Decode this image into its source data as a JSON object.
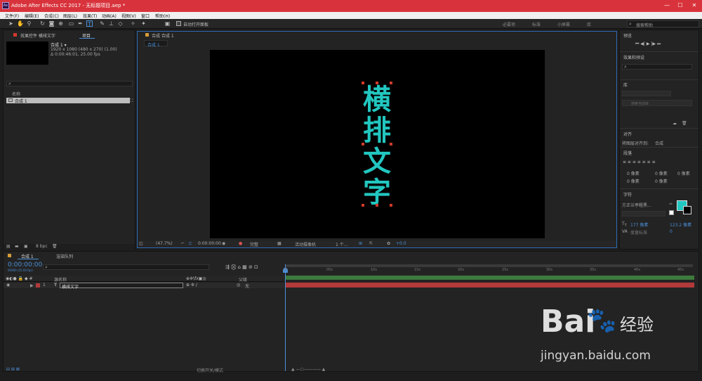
{
  "titlebar": {
    "app_icon": "Ae",
    "title": "Adobe After Effects CC 2017 - 无标题项目.aep *",
    "minimize": "—",
    "maximize": "☐",
    "close": "✕"
  },
  "menu": [
    "文件(F)",
    "编辑(E)",
    "合成(C)",
    "图层(L)",
    "效果(T)",
    "动画(A)",
    "视图(V)",
    "窗口",
    "帮助(H)"
  ],
  "toolbar": {
    "auto_open": "自动打开面板",
    "workspaces": [
      "必要项",
      "标准",
      "小屏幕",
      "库"
    ],
    "search_placeholder": "搜索帮助"
  },
  "project": {
    "tab_effects": "效果控件 横排文字",
    "tab_project": "项目",
    "comp_name": "合成 1 ▾",
    "comp_info1": "1920 x 1080 (480 x 270) (1.00)",
    "comp_info2": "Δ 0:00:46:01, 25.00 fps",
    "col_name": "名称",
    "item": "合成 1",
    "bpc": "8 bpc"
  },
  "viewer": {
    "tab": "合成 合成 1",
    "sub_tab": "合成 1",
    "text_chars": [
      "横",
      "排",
      "文",
      "字"
    ],
    "zoom": "(47.7%)",
    "timecode": "0:00:00:00",
    "quality": "完整",
    "camera": "活动摄像机",
    "view": "1 个...",
    "offset": "+0.0"
  },
  "timeline": {
    "tab1": "合成 1",
    "tab2": "渲染队列",
    "time": "0:00:00:00",
    "frames": "00000 (25.00 fps)",
    "col_source": "源名称",
    "col_parent": "父级",
    "layer_num": "1",
    "layer_name": "横排文字",
    "parent_val": "无",
    "ticks": [
      "0s",
      "05s",
      "10s",
      "15s",
      "20s",
      "25s",
      "30s",
      "35s",
      "40s",
      "45s"
    ],
    "switch_label": "切换开关/模式"
  },
  "right": {
    "preview": "预览",
    "effects": "效果和预设",
    "library": "库",
    "lib_search": "搜索当前库",
    "align": "对齐",
    "align_to_label": "将图层对齐到:",
    "align_to": "合成",
    "paragraph": "段落",
    "para_vals": [
      "0 像素",
      "0 像素",
      "0 像素",
      "0 像素",
      "0 像素"
    ],
    "character": "字符",
    "font": "方正兰亭粗黑...",
    "font_size": "177 像素",
    "leading": "123.2 像素",
    "tracking_label": "度量标准",
    "tracking_val": "0"
  },
  "colors": {
    "accent": "#22c7c0",
    "title_bar": "#d8333c",
    "selection": "#2d6bb5",
    "layer_bar": "#b33a3a"
  },
  "watermark": {
    "text1": "Bai",
    "text2": "经验",
    "url": "jingyan.baidu.com"
  }
}
